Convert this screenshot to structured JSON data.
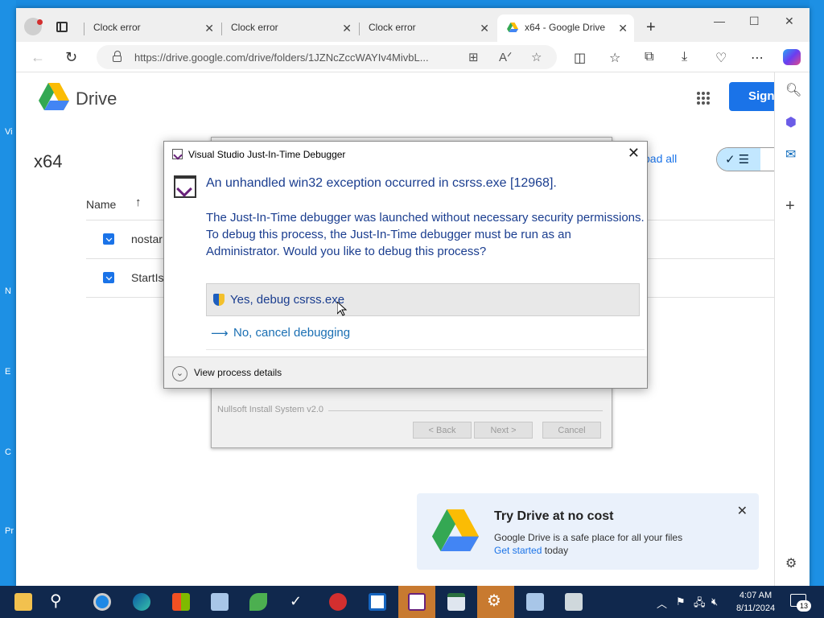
{
  "desktop": {
    "left_labels": [
      "Vi",
      "N",
      "E",
      "C",
      "Pr"
    ]
  },
  "browser": {
    "tabs": [
      {
        "label": "Clock error"
      },
      {
        "label": "Clock error"
      },
      {
        "label": "Clock error"
      },
      {
        "label": "x64 - Google Drive"
      }
    ],
    "url": "https://drive.google.com/drive/folders/1JZNcZccWAYIv4MivbL..."
  },
  "drive": {
    "logo_text": "Drive",
    "signin_label": "Sign",
    "folder_title": "x64",
    "download_all": "oad all",
    "column_name": "Name",
    "files": [
      {
        "name": "nostar"
      },
      {
        "name": "StartIs"
      }
    ],
    "try_card": {
      "title": "Try Drive at no cost",
      "subtitle": "Google Drive is a safe place for all your files",
      "link": "Get started",
      "link_suffix": " today"
    }
  },
  "installer": {
    "brand": "Nullsoft Install System v2.0",
    "back": "< Back",
    "next": "Next >",
    "cancel": "Cancel"
  },
  "dialog": {
    "title": "Visual Studio Just-In-Time Debugger",
    "heading": "An unhandled win32 exception occurred in csrss.exe [12968].",
    "body": "The Just-In-Time debugger was launched without necessary security permissions. To debug this process, the Just-In-Time debugger must be run as an Administrator. Would you like to debug this process?",
    "yes_label": "Yes, debug csrss.exe",
    "no_label": "No, cancel debugging",
    "details_label": "View process details"
  },
  "taskbar": {
    "time": "4:07 AM",
    "date": "8/11/2024",
    "notification_count": "13"
  },
  "colors": {
    "accent": "#1a73e8",
    "dialog_text": "#1a3d8f",
    "taskbar": "#10284d",
    "desktop": "#1a8be0"
  }
}
